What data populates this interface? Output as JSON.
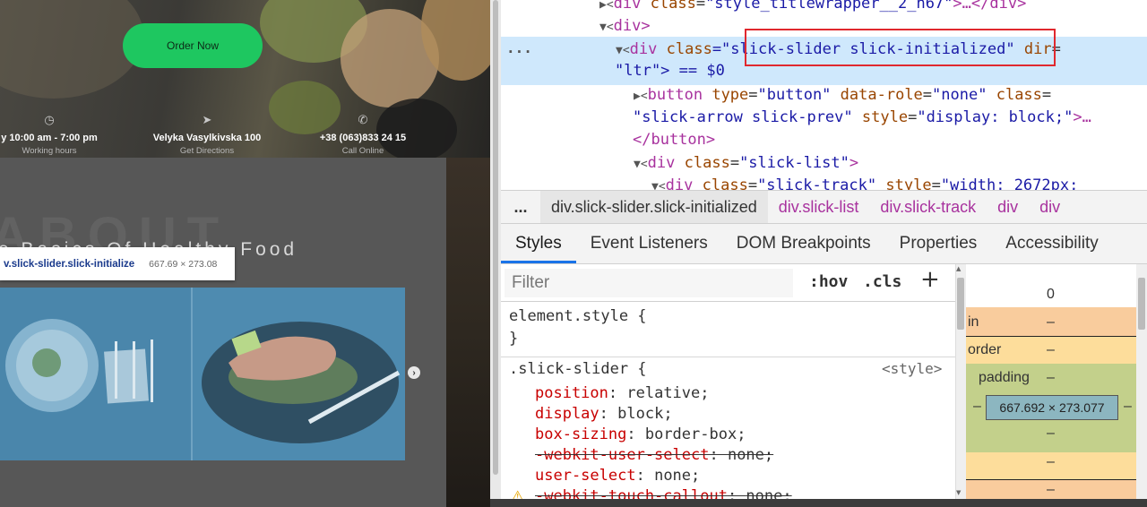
{
  "website": {
    "order_button": "Order Now",
    "info": [
      {
        "icon": "clock-icon",
        "main": "y 10:00 am - 7:00 pm",
        "sub": "Working hours"
      },
      {
        "icon": "navigation-arrow-icon",
        "main": "Velyka Vasylkivska 100",
        "sub": "Get Directions"
      },
      {
        "icon": "phone-icon",
        "main": "+38 (063)833 24 15",
        "sub": "Call Online"
      }
    ],
    "about_big": "ABOUT",
    "about_sub": "e Basics Of Healthy Food",
    "tooltip": {
      "selector": "v.slick-slider.slick-initialize",
      "dimensions": "667.69 × 273.08"
    },
    "next_arrow": "›"
  },
  "devtools": {
    "dom_lines": [
      {
        "open": "▶<",
        "tag": "div",
        "attr": "class",
        "val": "\"style_titlewrapper__2_h67\"",
        "rest": ">…</",
        "end": "div>"
      },
      {
        "open": "▼<",
        "tag": "div",
        "rest": ">"
      },
      {
        "open": "▼<",
        "tag": "div",
        "attr": "class",
        "val_pre": "=\"",
        "val": "slick-slider slick-initialized",
        "val_post": "\"",
        "attr2": "dir",
        "eq": "="
      },
      {
        "text": "\"ltr\"> == $0"
      },
      {
        "open": "▶<",
        "tag": "button",
        "attr": "type",
        "val": "\"button\"",
        "attr2": "data-role",
        "val2": "\"none\"",
        "attr3": "class",
        "eq": "="
      },
      {
        "val": "\"slick-arrow slick-prev\"",
        "attr": "style",
        "val2": "\"display: block;\"",
        "rest": ">…"
      },
      {
        "text": "</button>"
      },
      {
        "open": "▼<",
        "tag": "div",
        "attr": "class",
        "val": "\"slick-list\"",
        "rest": ">"
      },
      {
        "open": "▼<",
        "tag": "div",
        "attr": "class",
        "val": "\"slick-track\"",
        "attr2": "style",
        "val2": "\"width: 2672px;"
      }
    ],
    "dom_dots": "...",
    "breadcrumbs": {
      "dots": "...",
      "items": [
        "div.slick-slider.slick-initialized",
        "div.slick-list",
        "div.slick-track",
        "div",
        "div"
      ]
    },
    "tabs": [
      "Styles",
      "Event Listeners",
      "DOM Breakpoints",
      "Properties",
      "Accessibility"
    ],
    "filter": {
      "placeholder": "Filter",
      "hov": ":hov",
      "cls": ".cls",
      "add": "+"
    },
    "styles": {
      "element_style_open": "element.style {",
      "element_style_close": "}",
      "rule_selector": ".slick-slider {",
      "rule_source": "<style>",
      "declarations": [
        {
          "prop": "position",
          "value": "relative;",
          "struck": false
        },
        {
          "prop": "display",
          "value": "block;",
          "struck": false
        },
        {
          "prop": "box-sizing",
          "value": "border-box;",
          "struck": false
        },
        {
          "prop": "-webkit-user-select",
          "value": "none;",
          "struck": true
        },
        {
          "prop": "user-select",
          "value": "none;",
          "struck": false
        },
        {
          "prop": "-webkit-touch-callout",
          "value": "none;",
          "struck": true
        }
      ]
    },
    "boxmodel": {
      "top_value": "0",
      "margin_label": "in",
      "margin_value": "–",
      "border_label": "order",
      "border_value": "–",
      "padding_label": "padding",
      "padding_value": "–",
      "left_value": "–",
      "right_value": "–",
      "content": "667.692 × 273.077",
      "padding_bottom": "–",
      "border_bottom": "–",
      "margin_bottom": "–"
    }
  }
}
